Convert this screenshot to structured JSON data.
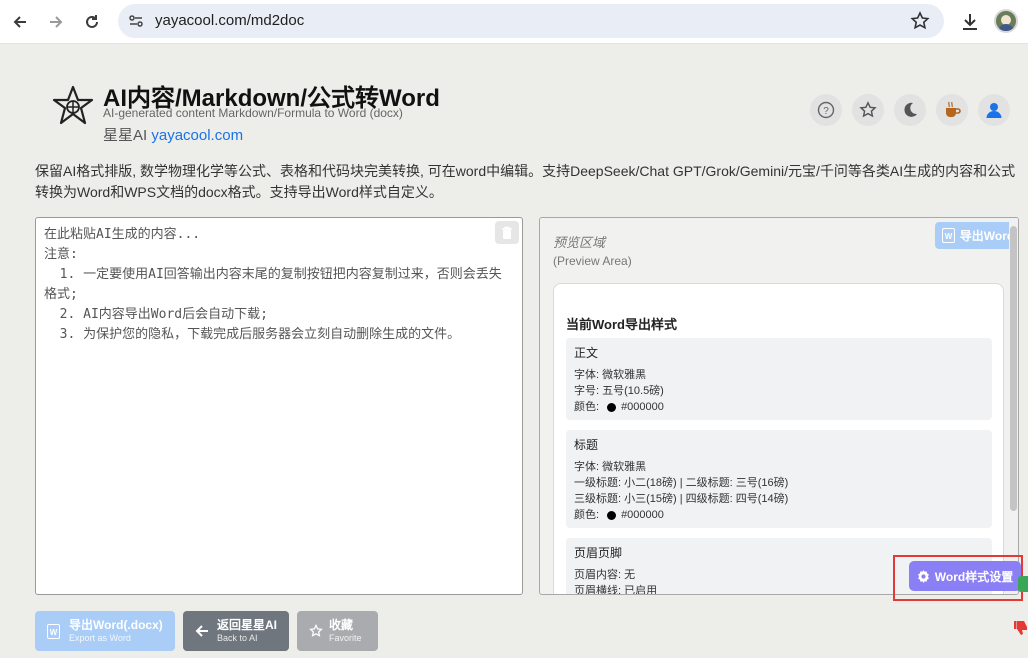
{
  "browser": {
    "url": "yayacool.com/md2doc"
  },
  "header": {
    "title": "AI内容/Markdown/公式转Word",
    "subtitle": "AI-generated content Markdown/Formula to Word (docx)",
    "brand_prefix": "星星AI",
    "brand_link": "yayacool.com",
    "icons": [
      "help-circle-icon",
      "star-icon",
      "moon-icon",
      "coffee-icon",
      "user-icon"
    ]
  },
  "description": "保留AI格式排版, 数学物理化学等公式、表格和代码块完美转换, 可在word中编辑。支持DeepSeek/Chat GPT/Grok/Gemini/元宝/千问等各类AI生成的内容和公式转换为Word和WPS文档的docx格式。支持导出Word样式自定义。",
  "editor": {
    "placeholder": "在此粘贴AI生成的内容...\n注意:\n  1. 一定要使用AI回答输出内容末尾的复制按钮把内容复制过来，否则会丢失格式;\n  2. AI内容导出Word后会自动下载;\n  3. 为保护您的隐私，下载完成后服务器会立刻自动删除生成的文件。"
  },
  "preview": {
    "title": "预览区域",
    "subtitle": "(Preview Area)",
    "export_button": "导出Word",
    "card_title": "当前Word导出样式",
    "sections": [
      {
        "heading": "正文",
        "font": "字体: 微软雅黑",
        "size": "字号: 五号(10.5磅)",
        "color_label": "颜色:",
        "color_value": "#000000"
      },
      {
        "heading": "标题",
        "font": "字体: 微软雅黑",
        "line1": "一级标题: 小二(18磅) | 二级标题: 三号(16磅)",
        "line2": "三级标题: 小三(15磅) | 四级标题: 四号(14磅)",
        "color_label": "颜色:",
        "color_value": "#000000"
      },
      {
        "heading": "页眉页脚",
        "content": "页眉内容: 无",
        "line": "页眉横线: 已启用"
      }
    ],
    "style_settings_button": "Word样式设置"
  },
  "bottom_buttons": {
    "export": {
      "label": "导出Word(.docx)",
      "sub": "Export as Word"
    },
    "back": {
      "label": "返回星星AI",
      "sub": "Back to AI"
    },
    "favorite": {
      "label": "收藏",
      "sub": "Favorite"
    }
  },
  "colors": {
    "accent_blue": "#a9cdf6",
    "link_blue": "#1a73e8",
    "settings_purple": "#8b7ff5",
    "highlight_red": "#e53935"
  }
}
